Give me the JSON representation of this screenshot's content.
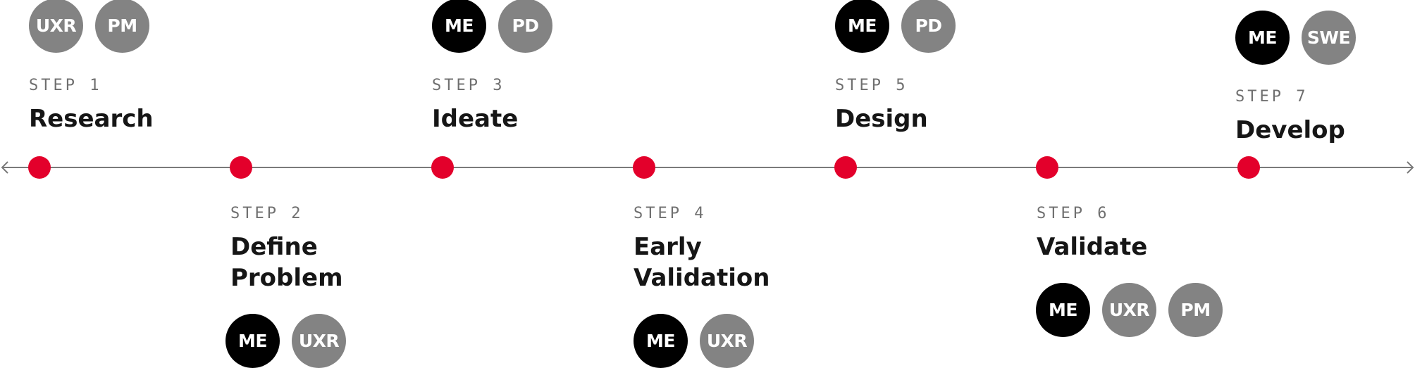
{
  "colors": {
    "axis_line": "#7a7a7a",
    "milestone_dot": "#e3002b",
    "role_primary": "#000000",
    "role_secondary": "#838383",
    "step_label": "#6f6f6f",
    "step_title": "#161616"
  },
  "steps": [
    {
      "label": "STEP 1",
      "title": "Research",
      "roles": [
        {
          "text": "UXR",
          "kind": "secondary"
        },
        {
          "text": "PM",
          "kind": "secondary"
        }
      ]
    },
    {
      "label": "STEP 2",
      "title": "Define\nProblem",
      "roles": [
        {
          "text": "ME",
          "kind": "primary"
        },
        {
          "text": "UXR",
          "kind": "secondary"
        }
      ]
    },
    {
      "label": "STEP 3",
      "title": "Ideate",
      "roles": [
        {
          "text": "ME",
          "kind": "primary"
        },
        {
          "text": "PD",
          "kind": "secondary"
        }
      ]
    },
    {
      "label": "STEP 4",
      "title": "Early\nValidation",
      "roles": [
        {
          "text": "ME",
          "kind": "primary"
        },
        {
          "text": "UXR",
          "kind": "secondary"
        }
      ]
    },
    {
      "label": "STEP 5",
      "title": "Design",
      "roles": [
        {
          "text": "ME",
          "kind": "primary"
        },
        {
          "text": "PD",
          "kind": "secondary"
        }
      ]
    },
    {
      "label": "STEP 6",
      "title": "Validate",
      "roles": [
        {
          "text": "ME",
          "kind": "primary"
        },
        {
          "text": "UXR",
          "kind": "secondary"
        },
        {
          "text": "PM",
          "kind": "secondary"
        }
      ]
    },
    {
      "label": "STEP 7",
      "title": "Develop",
      "roles": [
        {
          "text": "ME",
          "kind": "primary"
        },
        {
          "text": "SWE",
          "kind": "secondary"
        }
      ]
    }
  ]
}
